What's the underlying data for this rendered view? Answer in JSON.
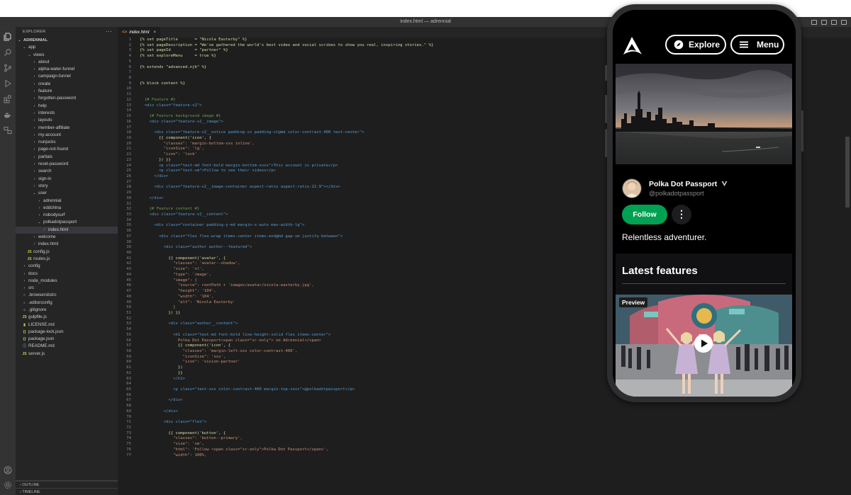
{
  "window": {
    "title": "index.html — adrennial"
  },
  "sidebar": {
    "header": "EXPLORER",
    "more": "···",
    "tree": [
      {
        "label": "ADRENNIAL",
        "depth": 0,
        "kind": "root"
      },
      {
        "label": "app",
        "depth": 1,
        "kind": "open"
      },
      {
        "label": "views",
        "depth": 2,
        "kind": "open"
      },
      {
        "label": "about",
        "depth": 3,
        "kind": "closed"
      },
      {
        "label": "alpha-water-funnel",
        "depth": 3,
        "kind": "closed"
      },
      {
        "label": "campaign-funnel",
        "depth": 3,
        "kind": "closed"
      },
      {
        "label": "create",
        "depth": 3,
        "kind": "closed"
      },
      {
        "label": "feature",
        "depth": 3,
        "kind": "closed"
      },
      {
        "label": "forgotten-password",
        "depth": 3,
        "kind": "closed"
      },
      {
        "label": "help",
        "depth": 3,
        "kind": "closed"
      },
      {
        "label": "interests",
        "depth": 3,
        "kind": "closed"
      },
      {
        "label": "layouts",
        "depth": 3,
        "kind": "closed"
      },
      {
        "label": "member-affiliate",
        "depth": 3,
        "kind": "closed"
      },
      {
        "label": "my-account",
        "depth": 3,
        "kind": "closed"
      },
      {
        "label": "nunjucks",
        "depth": 3,
        "kind": "closed"
      },
      {
        "label": "page-not-found",
        "depth": 3,
        "kind": "closed"
      },
      {
        "label": "partials",
        "depth": 3,
        "kind": "closed"
      },
      {
        "label": "reset-password",
        "depth": 3,
        "kind": "closed"
      },
      {
        "label": "search",
        "depth": 3,
        "kind": "closed"
      },
      {
        "label": "sign-in",
        "depth": 3,
        "kind": "closed"
      },
      {
        "label": "story",
        "depth": 3,
        "kind": "closed"
      },
      {
        "label": "user",
        "depth": 3,
        "kind": "open"
      },
      {
        "label": "adrennial",
        "depth": 4,
        "kind": "closed"
      },
      {
        "label": "eddchina",
        "depth": 4,
        "kind": "closed"
      },
      {
        "label": "nobodysurf",
        "depth": 4,
        "kind": "closed"
      },
      {
        "label": "polkadotpassport",
        "depth": 4,
        "kind": "open"
      },
      {
        "label": "index.html",
        "depth": 5,
        "kind": "html",
        "selected": true
      },
      {
        "label": "welcome",
        "depth": 3,
        "kind": "closed"
      },
      {
        "label": "index.html",
        "depth": 3,
        "kind": "html"
      },
      {
        "label": "config.js",
        "depth": 2,
        "kind": "js"
      },
      {
        "label": "routes.js",
        "depth": 2,
        "kind": "js"
      },
      {
        "label": "config",
        "depth": 1,
        "kind": "closed"
      },
      {
        "label": "docs",
        "depth": 1,
        "kind": "closed"
      },
      {
        "label": "node_modules",
        "depth": 1,
        "kind": "closed"
      },
      {
        "label": "src",
        "depth": 1,
        "kind": "closed"
      },
      {
        "label": ".browserslistrc",
        "depth": 1,
        "kind": "plain"
      },
      {
        "label": ".editorconfig",
        "depth": 1,
        "kind": "plain"
      },
      {
        "label": ".gitignore",
        "depth": 1,
        "kind": "git"
      },
      {
        "label": "gulpfile.js",
        "depth": 1,
        "kind": "js"
      },
      {
        "label": "LICENSE.md",
        "depth": 1,
        "kind": "lic"
      },
      {
        "label": "package-lock.json",
        "depth": 1,
        "kind": "json"
      },
      {
        "label": "package.json",
        "depth": 1,
        "kind": "json"
      },
      {
        "label": "README.md",
        "depth": 1,
        "kind": "md"
      },
      {
        "label": "server.js",
        "depth": 1,
        "kind": "js"
      }
    ],
    "outline": "OUTLINE",
    "timeline": "TIMELINE"
  },
  "tab": {
    "label": "index.html",
    "icon": "<>",
    "close": "×"
  },
  "code": [
    {
      "n": 1,
      "t": "{% set pageTitle       = \"Nicola Easterby\" %}",
      "c": "kw"
    },
    {
      "n": 2,
      "t": "{% set pageDescription = \"We've gathered the world's best video and social scribes to show you real, inspiring stories.\" %}",
      "c": "kw"
    },
    {
      "n": 3,
      "t": "{% set pageId          = \"partner\" %}",
      "c": "kw"
    },
    {
      "n": 4,
      "t": "{% set exploreMenu     = true %}",
      "c": "kw"
    },
    {
      "n": 5,
      "t": "",
      "c": ""
    },
    {
      "n": 6,
      "t": "{% extends \"advanced.njk\" %}",
      "c": "kw"
    },
    {
      "n": 7,
      "t": "",
      "c": ""
    },
    {
      "n": 8,
      "t": "",
      "c": ""
    },
    {
      "n": 9,
      "t": "{% block content %}",
      "c": "kw"
    },
    {
      "n": 10,
      "t": "",
      "c": ""
    },
    {
      "n": 11,
      "t": "",
      "c": ""
    },
    {
      "n": 12,
      "t": "  {# Feature #}",
      "c": "com"
    },
    {
      "n": 13,
      "t": "  <div class=\"feature-v2\">",
      "c": "tag"
    },
    {
      "n": 14,
      "t": "",
      "c": ""
    },
    {
      "n": 15,
      "t": "    {# Feature background image #}",
      "c": "com"
    },
    {
      "n": 16,
      "t": "    <div class=\"feature-v2__image\">",
      "c": "tag"
    },
    {
      "n": 17,
      "t": "",
      "c": ""
    },
    {
      "n": 18,
      "t": "      <div class=\"feature-v2__notice padding-xs padding-xl@md color-contrast-400 text-center\">",
      "c": "tag"
    },
    {
      "n": 19,
      "t": "        {{ component('icon', {",
      "c": "kw"
    },
    {
      "n": 20,
      "t": "          \"classes\": 'margin-bottom-xxs inline',",
      "c": "plain"
    },
    {
      "n": 21,
      "t": "          \"iconSize\": 'lg',",
      "c": "plain"
    },
    {
      "n": 22,
      "t": "          \"icon\": 'lock'",
      "c": "plain"
    },
    {
      "n": 23,
      "t": "        }) }}",
      "c": "kw"
    },
    {
      "n": 24,
      "t": "        <p class=\"text-md font-bold margin-bottom-xxxs\">This account is private</p>",
      "c": "tag"
    },
    {
      "n": 25,
      "t": "        <p class=\"text-sm\">Follow to see their videos</p>",
      "c": "tag"
    },
    {
      "n": 26,
      "t": "      </div>",
      "c": "tag"
    },
    {
      "n": 27,
      "t": "",
      "c": ""
    },
    {
      "n": 28,
      "t": "      <div class=\"feature-v2__image-container aspect-ratio aspect-ratio-21:9\"></div>",
      "c": "tag"
    },
    {
      "n": 29,
      "t": "",
      "c": ""
    },
    {
      "n": 30,
      "t": "    </div>",
      "c": "tag"
    },
    {
      "n": 31,
      "t": "",
      "c": ""
    },
    {
      "n": 32,
      "t": "    {# Feature content #}",
      "c": "com"
    },
    {
      "n": 33,
      "t": "    <div class=\"feature-v2__content\">",
      "c": "tag"
    },
    {
      "n": 34,
      "t": "",
      "c": ""
    },
    {
      "n": 35,
      "t": "      <div class=\"container padding-y-md margin-x-auto max-width-lg\">",
      "c": "tag"
    },
    {
      "n": 36,
      "t": "",
      "c": ""
    },
    {
      "n": 37,
      "t": "        <div class=\"flex flex-wrap items-center items-end@md gap-sm justify-between\">",
      "c": "tag"
    },
    {
      "n": 38,
      "t": "",
      "c": ""
    },
    {
      "n": 39,
      "t": "          <div class=\"author author--featured\">",
      "c": "tag"
    },
    {
      "n": 40,
      "t": "",
      "c": ""
    },
    {
      "n": 41,
      "t": "            {{ component('avatar', {",
      "c": "kw"
    },
    {
      "n": 42,
      "t": "              \"classes\": 'avatar--shadow',",
      "c": "plain"
    },
    {
      "n": 43,
      "t": "              \"size\": 'xl',",
      "c": "plain"
    },
    {
      "n": 44,
      "t": "              \"type\": 'image',",
      "c": "plain"
    },
    {
      "n": 45,
      "t": "              \"image\": {",
      "c": "plain"
    },
    {
      "n": 46,
      "t": "                \"source\": rootPath + 'images/avatar/nicola-easterby.jpg',",
      "c": "plain"
    },
    {
      "n": 47,
      "t": "                \"height\": '104',",
      "c": "plain"
    },
    {
      "n": 48,
      "t": "                \"width\": '104',",
      "c": "plain"
    },
    {
      "n": 49,
      "t": "                \"alt\": 'Nicola Easterby'",
      "c": "plain"
    },
    {
      "n": 50,
      "t": "              }",
      "c": "plain"
    },
    {
      "n": 51,
      "t": "            }) }}",
      "c": "kw"
    },
    {
      "n": 52,
      "t": "",
      "c": ""
    },
    {
      "n": 53,
      "t": "            <div class=\"author__content\">",
      "c": "tag"
    },
    {
      "n": 54,
      "t": "",
      "c": ""
    },
    {
      "n": 55,
      "t": "              <h1 class=\"text-md font-bold line-height-solid flex items-center\">",
      "c": "tag"
    },
    {
      "n": 56,
      "t": "                Polka Dot Passport<span class=\"sr-only\"> on Adrennial</span>",
      "c": "plain"
    },
    {
      "n": 57,
      "t": "                {{ component('icon', {",
      "c": "kw"
    },
    {
      "n": 58,
      "t": "                  \"classes\": 'margin-left-xxs color-contrast-400',",
      "c": "plain"
    },
    {
      "n": 59,
      "t": "                  \"iconSize\": 'xxs',",
      "c": "plain"
    },
    {
      "n": 60,
      "t": "                  \"icon\": 'vision-partner'",
      "c": "plain"
    },
    {
      "n": 61,
      "t": "                })",
      "c": "kw"
    },
    {
      "n": 62,
      "t": "                }}",
      "c": "kw"
    },
    {
      "n": 63,
      "t": "              </h1>",
      "c": "tag"
    },
    {
      "n": 64,
      "t": "",
      "c": ""
    },
    {
      "n": 65,
      "t": "              <p class=\"text-xxs color-contrast-400 margin-top-xxxs\">@polkadotpassport</p>",
      "c": "tag"
    },
    {
      "n": 66,
      "t": "",
      "c": ""
    },
    {
      "n": 67,
      "t": "            </div>",
      "c": "tag"
    },
    {
      "n": 68,
      "t": "",
      "c": ""
    },
    {
      "n": 69,
      "t": "          </div>",
      "c": "tag"
    },
    {
      "n": 70,
      "t": "",
      "c": ""
    },
    {
      "n": 71,
      "t": "          <div class=\"flex\">",
      "c": "tag"
    },
    {
      "n": 72,
      "t": "",
      "c": ""
    },
    {
      "n": 73,
      "t": "            {{ component('button', {",
      "c": "kw"
    },
    {
      "n": 74,
      "t": "              \"classes\": 'button--primary',",
      "c": "plain"
    },
    {
      "n": 75,
      "t": "              \"size\": 'sm',",
      "c": "plain"
    },
    {
      "n": 76,
      "t": "              \"html\": 'Follow <span class=\"sr-only\">Polka Dot Passport</span>',",
      "c": "plain"
    },
    {
      "n": 77,
      "t": "              \"width\": 100%,",
      "c": "plain"
    }
  ],
  "phone": {
    "explore_label": "Explore",
    "menu_label": "Menu",
    "profile_name": "Polka Dot Passport",
    "profile_handle": "@polkadotpassport",
    "follow_label": "Follow",
    "more_label": "⋮",
    "bio": "Relentless adventurer.",
    "features_title": "Latest features",
    "preview_label": "Preview"
  },
  "colors": {
    "accent_green": "#00a152",
    "editor_bg": "#1e1e1e",
    "sidebar_bg": "#252526"
  }
}
